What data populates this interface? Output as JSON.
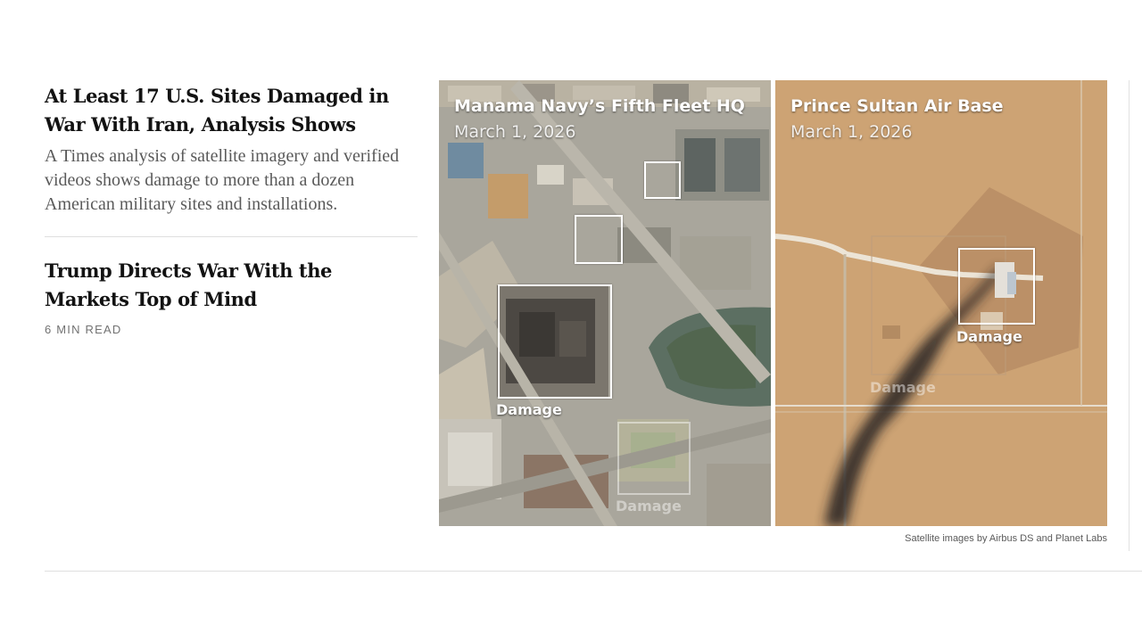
{
  "stories": [
    {
      "headline": "At Least 17 U.S. Sites Damaged in War With Iran, Analysis Shows",
      "summary": "A Times analysis of satellite imagery and verified videos shows damage to more than a dozen American military sites and installations."
    },
    {
      "headline": "Trump Directs War With the Markets Top of Mind",
      "read_time": "6 MIN READ"
    }
  ],
  "satellite": {
    "panels": [
      {
        "name": "Manama Navy’s Fifth Fleet HQ",
        "date": "March 1, 2026",
        "damage_label": "Damage",
        "faded_label": "Damage"
      },
      {
        "name": "Prince Sultan Air Base",
        "date": "March 1, 2026",
        "damage_label": "Damage",
        "faded_label": "Damage"
      }
    ],
    "credit": "Satellite images by Airbus DS and Planet Labs"
  }
}
